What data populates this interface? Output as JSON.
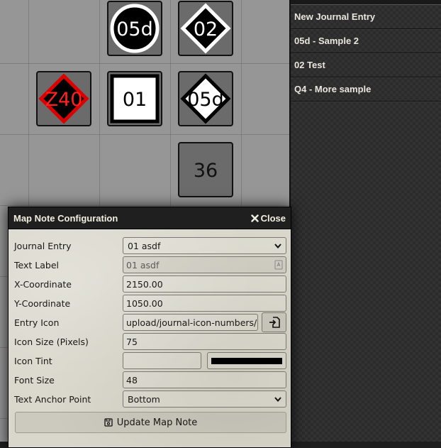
{
  "map": {
    "notes": [
      {
        "label": "05d",
        "shape": "circle",
        "fill": "#000000",
        "ring": "#ffffff",
        "text_color": "#ffffff"
      },
      {
        "label": "02",
        "shape": "diamond",
        "fill": "#000000",
        "ring": "#ffffff",
        "text_color": "#ffffff"
      },
      {
        "label": "Z40",
        "shape": "diamond",
        "fill": "#000000",
        "ring": "#dd0000",
        "text_color": "#ff2020"
      },
      {
        "label": "01",
        "shape": "square",
        "fill": "#ffffff",
        "ring": "#000000",
        "text_color": "#000000"
      },
      {
        "label": "05d",
        "shape": "diamond",
        "fill": "#ffffff",
        "ring": "#000000",
        "text_color": "#000000"
      },
      {
        "label": "36",
        "shape": "plain",
        "fill": "#6b6b6b",
        "ring": "#111111",
        "text_color": "#111111"
      }
    ]
  },
  "sidebar": {
    "journal_entries": [
      "New Journal Entry",
      "05d - Sample 2",
      "02 Test",
      "Q4 - More sample"
    ]
  },
  "dialog": {
    "title": "Map Note Configuration",
    "close_label": "Close",
    "fields": {
      "journal_entry": {
        "label": "Journal Entry",
        "value": "01 asdf"
      },
      "text_label": {
        "label": "Text Label",
        "placeholder": "01 asdf"
      },
      "x_coordinate": {
        "label": "X-Coordinate",
        "value": "2150.00"
      },
      "y_coordinate": {
        "label": "Y-Coordinate",
        "value": "1050.00"
      },
      "entry_icon": {
        "label": "Entry Icon",
        "value": "upload/journal-icon-numbers/"
      },
      "icon_size": {
        "label": "Icon Size (Pixels)",
        "value": "75"
      },
      "icon_tint": {
        "label": "Icon Tint",
        "value": "",
        "swatch": "#000000"
      },
      "font_size": {
        "label": "Font Size",
        "value": "48"
      },
      "text_anchor": {
        "label": "Text Anchor Point",
        "value": "Bottom"
      }
    },
    "submit_label": "Update Map Note"
  }
}
